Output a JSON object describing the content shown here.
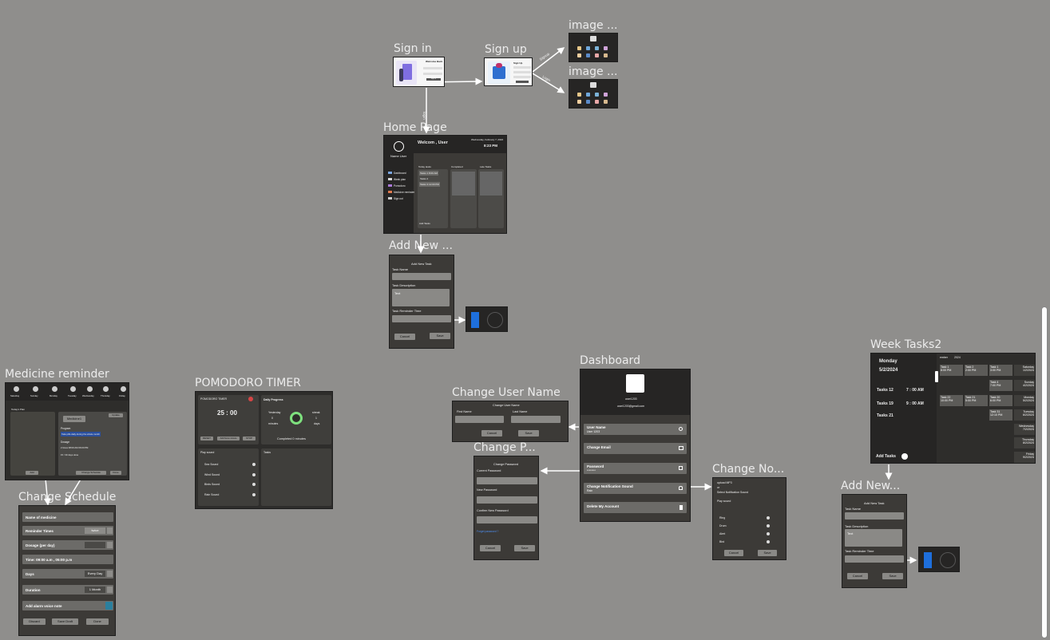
{
  "frames": {
    "sign_in": "Sign in",
    "sign_up": "Sign up",
    "image1": "image ...",
    "image2": "image ...",
    "home_page": "Home Page",
    "add_new_1": "Add New ...",
    "medicine": "Medicine reminder",
    "pomodoro": "POMODORO TIMER",
    "dashboard": "Dashboard",
    "change_user_name": "Change User Name",
    "change_password": "Change P...",
    "change_notification": "Change No...",
    "change_schedule": "Change Schedule",
    "week_tasks": "Week Tasks2",
    "add_new_2": "Add New..."
  },
  "signin": {
    "title": "Welcome Back",
    "button": "Sign In"
  },
  "signup": {
    "title": "Sign Up"
  },
  "arrows": {
    "signup_label": "signup",
    "login_label": "login",
    "image1_label": "Signup",
    "image2_label": "Login"
  },
  "home": {
    "welcome": "Welcom , User",
    "date": "Wednesday, February 7, 2024",
    "time": "8:23 PM",
    "user": "Name User",
    "menu": [
      "Dashboard",
      "Week plan",
      "Pomodoro",
      "Medicine reminder",
      "Sign out"
    ],
    "col1": "Today tasks",
    "col2": "Completed",
    "col3": "Late Tasks",
    "tasks": [
      "Tasks 1   8:00 AM",
      "Tasks 2",
      "Tasks 3   12:00 PM"
    ],
    "add_tasks": "Add Tasks"
  },
  "add_task": {
    "title": "Add New Task",
    "name": "Task Name",
    "desc": "Task Description",
    "desc_val": "Text",
    "reminder": "Task Reminder Time",
    "cancel": "Cancel",
    "save": "Save"
  },
  "medicine": {
    "days": [
      "Saturday",
      "Sunday",
      "Monday",
      "Tuesday",
      "Wednesday",
      "Thursday",
      "Friday"
    ],
    "today": "Today's Plan",
    "add": "Add",
    "change": "Change Schedule",
    "done": "Done",
    "med_name": "Medicine1",
    "edit": "Update",
    "program": "Program",
    "program_val": "Take pills daily during the whole month",
    "dosage": "Dosage",
    "dosage_val": "2 times   08:00 AM   06:00 PM",
    "days_left": "15 / 30 days done"
  },
  "schedule": {
    "name": "Name of medicine",
    "reminder": "Reminder Times",
    "reminder_val": "twice",
    "dosage": "Dosage (per day)",
    "time": "Time: 09:00 a.m , 05:00 p.m",
    "days": "Days",
    "days_val": "Every Day",
    "duration": "Duration",
    "duration_val": "1 Month",
    "alarm": "Add alarm voice note",
    "discard": "Discard",
    "draft": "Save Draft",
    "done": "Done"
  },
  "pomodoro": {
    "title": "POMODORO TIMER",
    "timer": "25 : 00",
    "reset": "RESET",
    "add_focus": "Add focus minute",
    "stop": "STOP",
    "progress": "Daily Progress",
    "yesterday": "Yesterday",
    "yesterday_val": "0",
    "minutes": "minutes",
    "streak": "streak",
    "streak_val": "1",
    "days": "days",
    "completed": "Completed 0 minutes",
    "play": "Play sound",
    "sounds": [
      "Sea Sound",
      "Wind Sound",
      "Birds Sound",
      "Rain Sound"
    ],
    "tasks": "Tasks"
  },
  "dashboard": {
    "user": "user1203",
    "email": "user1203@gmail.com",
    "items": [
      "User Name",
      "Change Email",
      "Password",
      "Change Notification Sound",
      "Delete My Account"
    ],
    "user_val": "User 1203",
    "pw_val": "********",
    "sound_val": "Rain"
  },
  "username": {
    "title": "Change User Name",
    "first": "First Name",
    "last": "Last Name",
    "cancel": "Cancel",
    "save": "Save"
  },
  "password": {
    "title": "Change Password",
    "current": "Current Password",
    "new": "New Password",
    "confirm": "Confirm New Password",
    "forgot": "Forget password ?",
    "cancel": "Cancel",
    "save": "Save"
  },
  "notification": {
    "line1": "upload MP3",
    "line2": "or",
    "line3": "Select Notification Sound",
    "play": "Play sound",
    "sounds": [
      "Ring",
      "Drum",
      "Alert",
      "Bird"
    ],
    "cancel": "Cancel",
    "save": "Save"
  },
  "week": {
    "month": "ember",
    "year": "2024",
    "day": "Monday",
    "date": "5/2/2024",
    "tasks": [
      [
        "Tasks 12",
        "7 : 00 AM"
      ],
      [
        "Tasks 19",
        "9 : 00 AM"
      ],
      [
        "Tasks 21",
        ""
      ]
    ],
    "add": "Add Tasks",
    "days": [
      [
        "Saturday",
        "1/2/2024"
      ],
      [
        "Sunday",
        "4/2/2024"
      ],
      [
        "Monday",
        "5/2/2024"
      ],
      [
        "Tuesday",
        "6/2/2024"
      ],
      [
        "Wednesday",
        "7/2/2024"
      ],
      [
        "Thursday",
        "8/2/2024"
      ],
      [
        "Friday",
        "9/2/2024"
      ]
    ],
    "cells": [
      "Task 1",
      "Task 2",
      "Task 1",
      "Task 4",
      "Task 22",
      "Task 21",
      "Task 20",
      "Task 31"
    ],
    "cell_times": [
      "8:00 PM",
      "2:00 PM",
      "3:00 PM",
      "7:00 PM",
      "10:00 PM",
      "5:00 PM",
      "6:00 PM",
      "12:10 PM"
    ]
  }
}
